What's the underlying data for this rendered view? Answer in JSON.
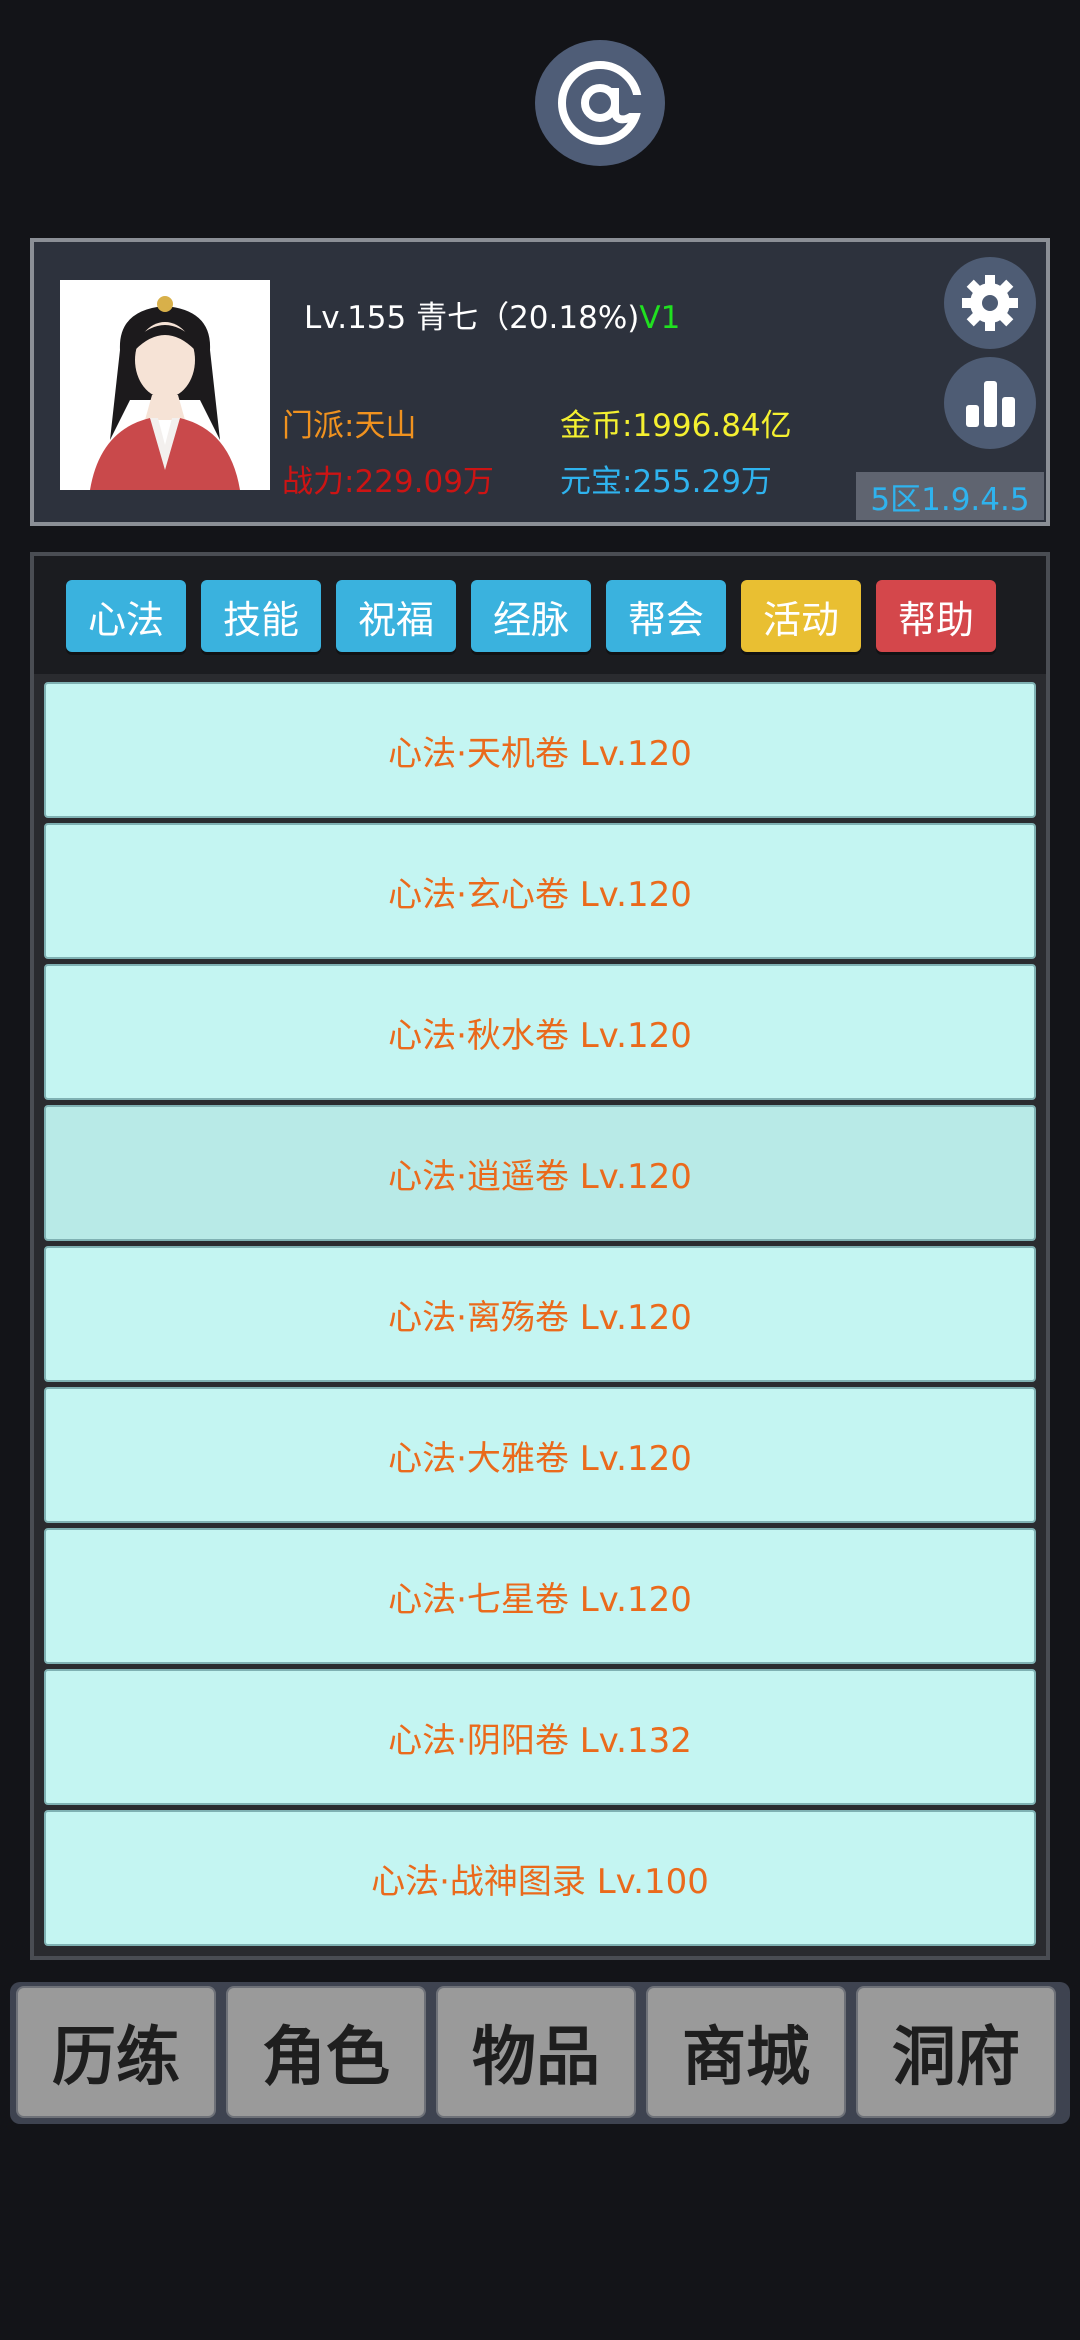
{
  "header": {
    "at_icon": "at-sign-icon"
  },
  "profile": {
    "level_text": "Lv.155 青七（20.18%)",
    "vip": "V1",
    "sect": "门派:天山",
    "power": "战力:229.09万",
    "gold": "金币:1996.84亿",
    "ingot": "元宝:255.29万",
    "server": "5区1.9.4.5",
    "settings_icon": "gear-icon",
    "rank_icon": "bar-chart-icon"
  },
  "tabs": [
    {
      "label": "心法",
      "color": "#3ab2de"
    },
    {
      "label": "技能",
      "color": "#3ab2de"
    },
    {
      "label": "祝福",
      "color": "#3ab2de"
    },
    {
      "label": "经脉",
      "color": "#3ab2de"
    },
    {
      "label": "帮会",
      "color": "#3ab2de"
    },
    {
      "label": "活动",
      "color": "#e9bf32"
    },
    {
      "label": "帮助",
      "color": "#d4474b"
    }
  ],
  "items": [
    {
      "label": "心法·天机卷 Lv.120"
    },
    {
      "label": "心法·玄心卷 Lv.120"
    },
    {
      "label": "心法·秋水卷 Lv.120"
    },
    {
      "label": "心法·逍遥卷 Lv.120"
    },
    {
      "label": "心法·离殇卷 Lv.120"
    },
    {
      "label": "心法·大雅卷 Lv.120"
    },
    {
      "label": "心法·七星卷 Lv.120"
    },
    {
      "label": "心法·阴阳卷 Lv.132"
    },
    {
      "label": "心法·战神图录 Lv.100"
    }
  ],
  "nav": [
    {
      "label": "历练"
    },
    {
      "label": "角色"
    },
    {
      "label": "物品"
    },
    {
      "label": "商城"
    },
    {
      "label": "洞府"
    }
  ]
}
